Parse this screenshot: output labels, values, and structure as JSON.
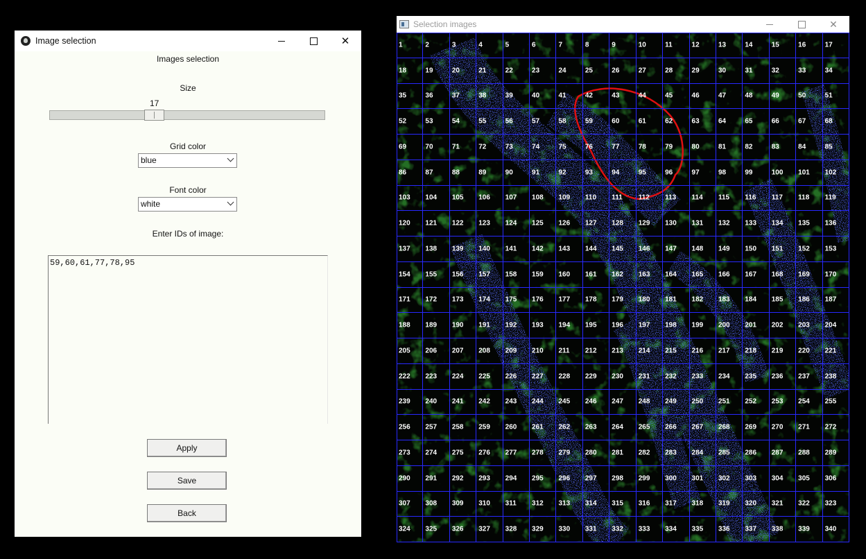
{
  "left_window": {
    "title": "Image selection",
    "heading": "Images selection",
    "size_label": "Size",
    "size_value": "17",
    "size_slider_fraction": 0.37,
    "grid_color_label": "Grid color",
    "grid_color_value": "blue",
    "font_color_label": "Font color",
    "font_color_value": "white",
    "ids_label": "Enter IDs of image:",
    "ids_value": "59,60,61,77,78,95",
    "apply_label": "Apply",
    "save_label": "Save",
    "back_label": "Back"
  },
  "right_window": {
    "title": "Selection images",
    "grid_columns": 17,
    "grid_rows": 20,
    "grid_color": "#2828ff",
    "font_color": "#ffffff",
    "highlight_color": "#e01010",
    "selected_ids": [
      59,
      60,
      61,
      77,
      78,
      95
    ]
  }
}
